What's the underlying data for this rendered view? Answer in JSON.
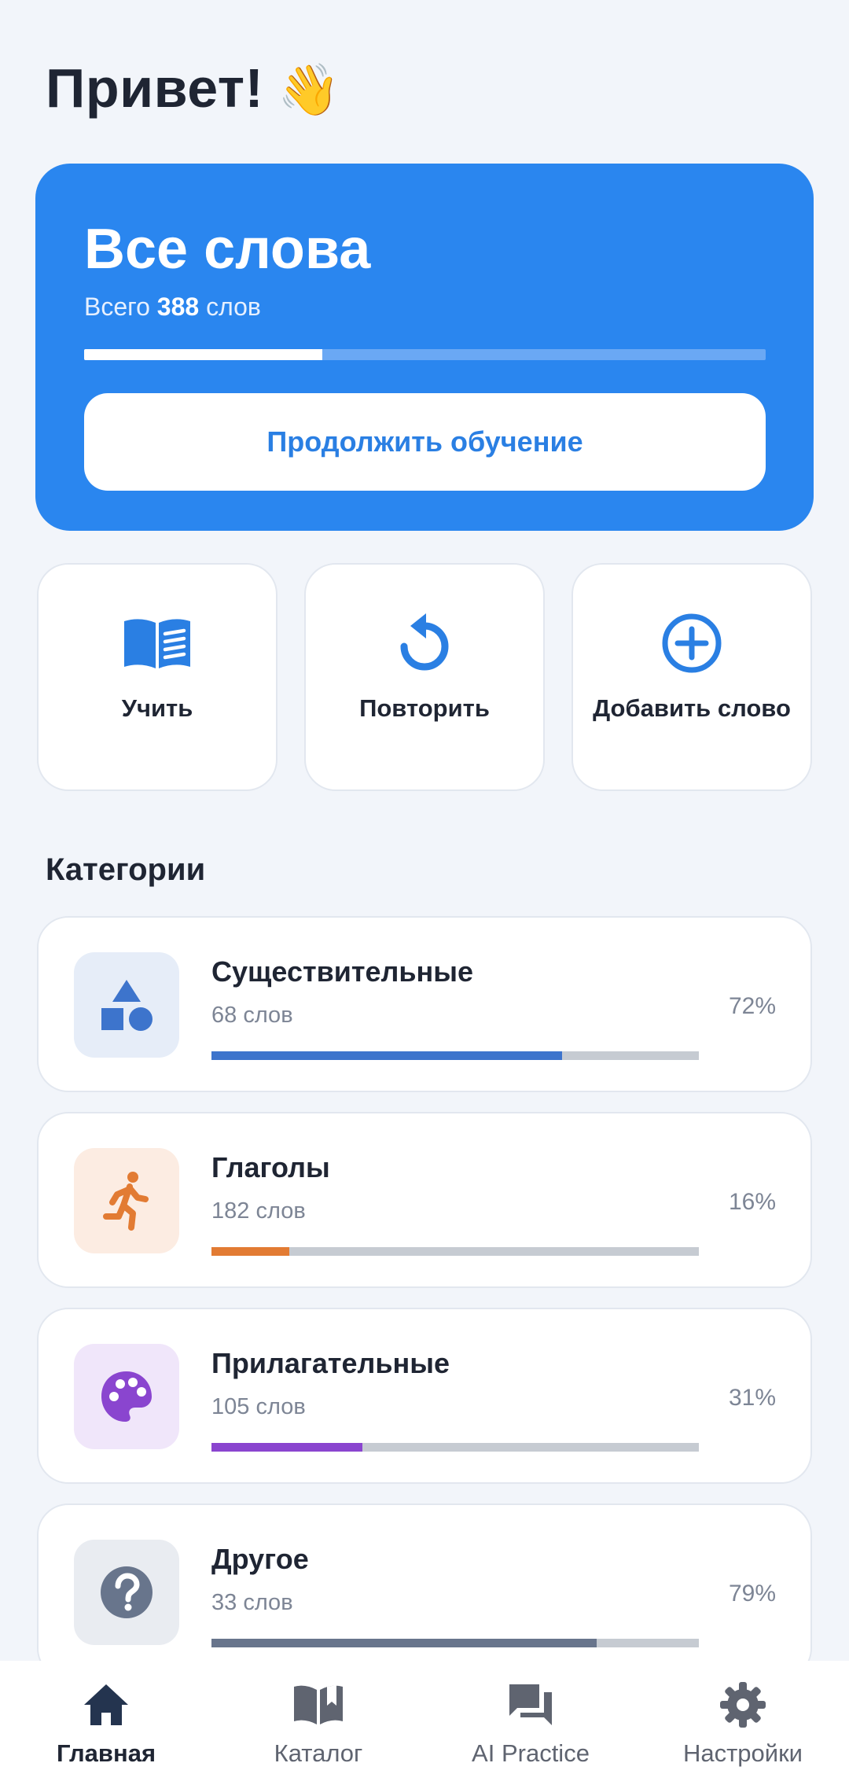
{
  "greeting": {
    "text": "Привет!",
    "emoji": "👋"
  },
  "hero": {
    "title": "Все слова",
    "subtitle_prefix": "Всего",
    "total_count": "388",
    "subtitle_suffix": "слов",
    "progress": 0.35,
    "continue_label": "Продолжить обучение",
    "color": "#2a86ef"
  },
  "actions": [
    {
      "label": "Учить",
      "icon": "open-book-icon"
    },
    {
      "label": "Повторить",
      "icon": "replay-icon"
    },
    {
      "label": "Добавить слово",
      "icon": "add-circle-icon"
    }
  ],
  "categories_title": "Категории",
  "categories": [
    {
      "name": "Существительные",
      "count": "68 слов",
      "percent": "72%",
      "progress": 0.72,
      "color": "#3d74cc",
      "tile_bg": "#e6edf8",
      "icon": "shapes-icon"
    },
    {
      "name": "Глаголы",
      "count": "182 слов",
      "percent": "16%",
      "progress": 0.16,
      "color": "#e27b33",
      "tile_bg": "#fcece2",
      "icon": "running-person-icon"
    },
    {
      "name": "Прилагательные",
      "count": "105 слов",
      "percent": "31%",
      "progress": 0.31,
      "color": "#8a45cf",
      "tile_bg": "#f0e6fa",
      "icon": "palette-icon"
    },
    {
      "name": "Другое",
      "count": "33 слов",
      "percent": "79%",
      "progress": 0.79,
      "color": "#68758c",
      "tile_bg": "#e9ecf1",
      "icon": "help-circle-icon"
    }
  ],
  "nav": [
    {
      "label": "Главная",
      "icon": "home-icon",
      "active": true
    },
    {
      "label": "Каталог",
      "icon": "catalog-book-icon",
      "active": false
    },
    {
      "label": "AI Practice",
      "icon": "chat-icon",
      "active": false
    },
    {
      "label": "Настройки",
      "icon": "gear-icon",
      "active": false
    }
  ]
}
